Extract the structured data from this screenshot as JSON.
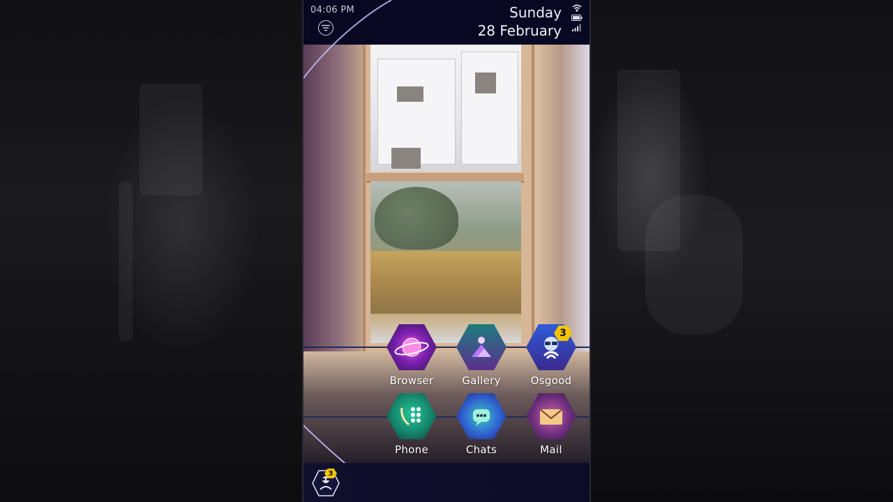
{
  "status_bar": {
    "time": "04:06 PM",
    "day": "Sunday",
    "date": "28 February"
  },
  "apps": [
    {
      "id": "browser",
      "label": "Browser",
      "badge": null
    },
    {
      "id": "gallery",
      "label": "Gallery",
      "badge": null
    },
    {
      "id": "osgood",
      "label": "Osgood",
      "badge": "3"
    },
    {
      "id": "phone",
      "label": "Phone",
      "badge": null
    },
    {
      "id": "chats",
      "label": "Chats",
      "badge": null
    },
    {
      "id": "mail",
      "label": "Mail",
      "badge": null
    }
  ],
  "dock": {
    "avatar_badge": "3"
  },
  "colors": {
    "accent": "#9b8cff",
    "badge": "#f4c400",
    "status_bg": "#080822"
  },
  "icons": {
    "menu": "menu-lines-icon",
    "wifi": "wifi-icon",
    "battery": "battery-icon",
    "signal": "signal-icon"
  }
}
